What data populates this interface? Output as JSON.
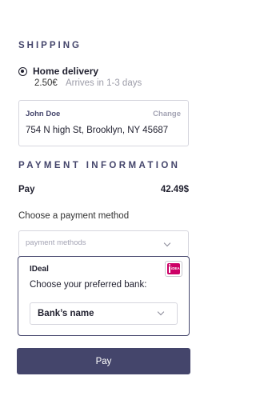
{
  "shipping": {
    "title": "SHIPPING",
    "option": {
      "label": "Home delivery",
      "price": "2.50€",
      "eta": "Arrives in 1-3 days",
      "selected": true
    },
    "address": {
      "name": "John Doe",
      "change_label": "Change",
      "line": "754 N high St, Brooklyn, NY 45687"
    }
  },
  "payment": {
    "title": "PAYMENT INFORMATION",
    "pay_label": "Pay",
    "amount": "42.49$",
    "method_prompt": "Choose a payment method",
    "method_placeholder": "payment methods",
    "ideal": {
      "title": "IDeal",
      "logo_text": "iDEAL",
      "bank_prompt": "Choose your preferred bank:",
      "bank_value": "Bank’s name"
    },
    "button_label": "Pay"
  },
  "colors": {
    "accent": "#44456b",
    "ideal_brand": "#cc0066"
  }
}
